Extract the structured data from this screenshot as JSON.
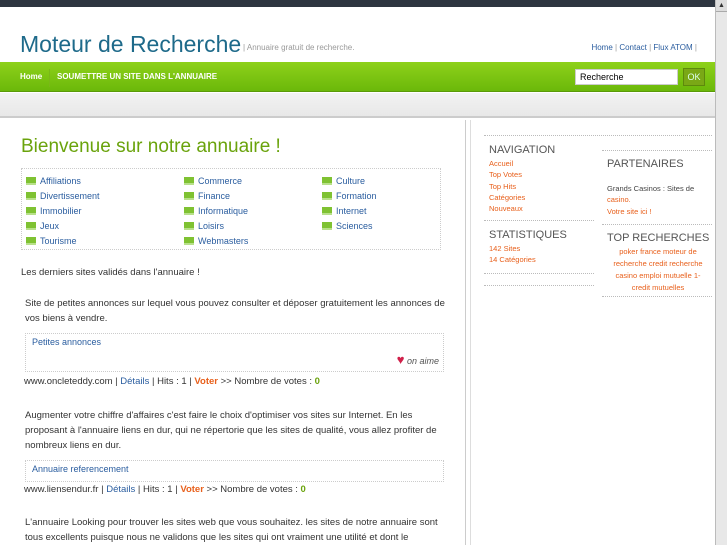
{
  "header": {
    "title": "Moteur de Recherche",
    "tagline": "| Annuaire gratuit de recherche.",
    "links": [
      "Home",
      "Contact",
      "Flux ATOM"
    ]
  },
  "nav": {
    "items": [
      "Home",
      "SOUMETTRE UN SITE DANS L'ANNUAIRE"
    ],
    "search_value": "Recherche",
    "search_button": "OK"
  },
  "main": {
    "title": "Bienvenue sur notre annuaire !",
    "categories": [
      "Affiliations",
      "Commerce",
      "Culture",
      "Divertissement",
      "Finance",
      "Formation",
      "Immobilier",
      "Informatique",
      "Internet",
      "Jeux",
      "Loisirs",
      "Sciences",
      "Tourisme",
      "Webmasters"
    ],
    "intro": "Les derniers sites validés dans l'annuaire !",
    "listings": [
      {
        "desc": "Site de petites annonces sur lequel vous pouvez consulter et déposer gratuitement les annonces de vos biens à vendre.",
        "title": "Petites annonces",
        "badge": "on aime",
        "url": "www.oncleteddy.com",
        "details": "Détails",
        "hits": "Hits : 1",
        "vote": "Voter",
        "votes_label": ">> Nombre de votes :",
        "votes": "0"
      },
      {
        "desc": "Augmenter votre chiffre d'affaires c'est faire le choix d'optimiser vos sites sur Internet. En les proposant à l'annuaire liens en dur, qui ne répertorie que les sites de qualité, vous allez profiter de nombreux liens en dur.",
        "title": "Annuaire referencement",
        "url": "www.liensendur.fr",
        "details": "Détails",
        "hits": "Hits : 1",
        "vote": "Voter",
        "votes_label": ">> Nombre de votes :",
        "votes": "0"
      },
      {
        "desc": "L'annuaire Looking pour trouver les sites web que vous souhaitez. les sites de notre annuaire sont tous excellents puisque nous ne validons que les sites qui ont vraiment une utilité et dont le"
      }
    ]
  },
  "sidebar": {
    "navigation": {
      "title": "NAVIGATION",
      "items": [
        "Accueil",
        "Top Votes",
        "Top Hits",
        "Catégories",
        "Nouveaux"
      ]
    },
    "stats": {
      "title": "STATISTIQUES",
      "items": [
        "142 Sites",
        "14 Catégories"
      ]
    },
    "partners": {
      "title": "PARTENAIRES",
      "text": "Grands Casinos : Sites de",
      "link1": "casino.",
      "link2": "Votre site ici !"
    },
    "top": {
      "title": "TOP RECHERCHES",
      "lines": [
        "poker france moteur de",
        "recherche credit recherche",
        "casino emploi mutuelle 1-",
        "credit mutuelles"
      ]
    }
  }
}
